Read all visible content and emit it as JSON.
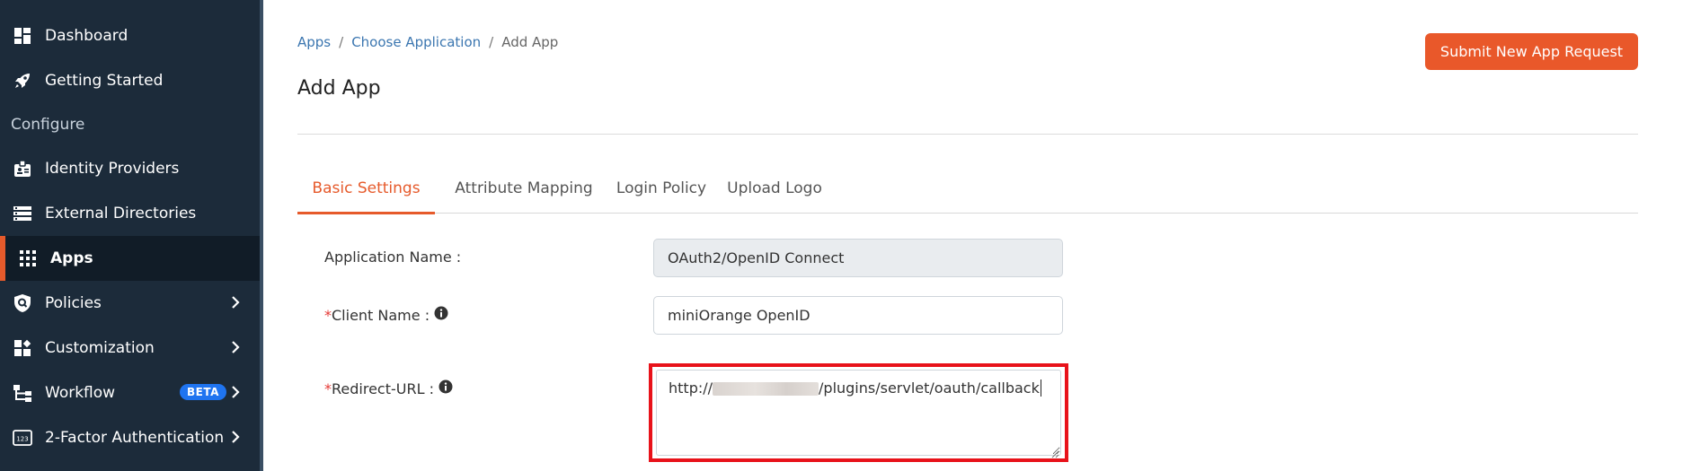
{
  "sidebar": {
    "items": [
      {
        "label": "Dashboard",
        "icon": "dashboard-icon"
      },
      {
        "label": "Getting Started",
        "icon": "rocket-icon"
      },
      {
        "label": "Identity Providers",
        "icon": "id-badge-icon"
      },
      {
        "label": "External Directories",
        "icon": "list-icon"
      },
      {
        "label": "Apps",
        "icon": "grid-icon",
        "active": true
      },
      {
        "label": "Policies",
        "icon": "shield-icon"
      },
      {
        "label": "Customization",
        "icon": "widgets-icon"
      },
      {
        "label": "Workflow",
        "icon": "workflow-icon",
        "badge": "BETA"
      },
      {
        "label": "2-Factor Authentication",
        "icon": "123-icon"
      }
    ],
    "section_configure": "Configure"
  },
  "breadcrumb": {
    "items": [
      "Apps",
      "Choose Application",
      "Add App"
    ],
    "separator": "/"
  },
  "page": {
    "title": "Add App",
    "submit_button": "Submit New App Request"
  },
  "tabs": [
    "Basic Settings",
    "Attribute Mapping",
    "Login Policy",
    "Upload Logo"
  ],
  "form": {
    "app_name_label": "Application Name :",
    "app_name_value": "OAuth2/OpenID Connect",
    "client_name_label": "Client Name :",
    "client_name_value": "miniOrange OpenID",
    "redirect_label": "Redirect-URL :",
    "redirect_prefix": "http://",
    "redirect_suffix": "/plugins/servlet/oauth/callback",
    "required_mark": "*"
  },
  "colors": {
    "sidebar_bg": "#1c2b3a",
    "accent": "#e65a2b",
    "link": "#3b76b0",
    "highlight": "#e8121a"
  }
}
